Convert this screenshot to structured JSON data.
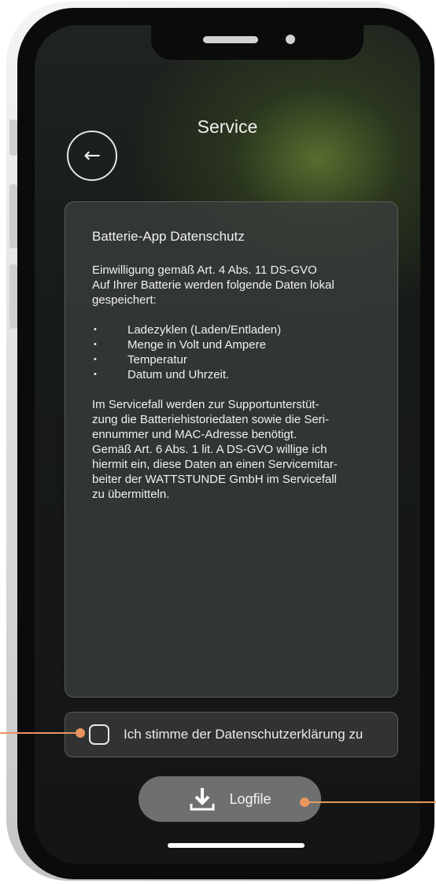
{
  "header": {
    "title": "Service"
  },
  "privacy": {
    "title": "Batterie-App Datenschutz",
    "consent_intro": [
      "Einwilligung gemäß Art. 4 Abs. 11 DS-GVO",
      "Auf Ihrer Batterie werden folgende Daten lokal",
      "gespeichert:"
    ],
    "items": [
      "Ladezyklen (Laden/Entladen)",
      "Menge in Volt und Ampere",
      "Temperatur",
      "Datum und Uhrzeit."
    ],
    "service_text": [
      "Im Servicefall werden zur Supportunterstüt-",
      "zung die Batteriehistoriedaten sowie die Seri-",
      "ennummer und MAC-Adresse benötigt.",
      "Gemäß Art. 6 Abs. 1 lit. A DS-GVO willige ich",
      "hiermit ein, diese Daten an einen Servicemitar-",
      "beiter der WATTSTUNDE GmbH im Servicefall",
      "zu übermitteln."
    ]
  },
  "consent": {
    "label": "Ich stimme der Datenschutzerklärung zu",
    "checked": false
  },
  "actions": {
    "logfile_label": "Logfile"
  },
  "icons": {
    "back": "arrow-left-icon",
    "download": "download-icon"
  },
  "colors": {
    "callout": "#e8965e",
    "button": "#6e706f"
  }
}
